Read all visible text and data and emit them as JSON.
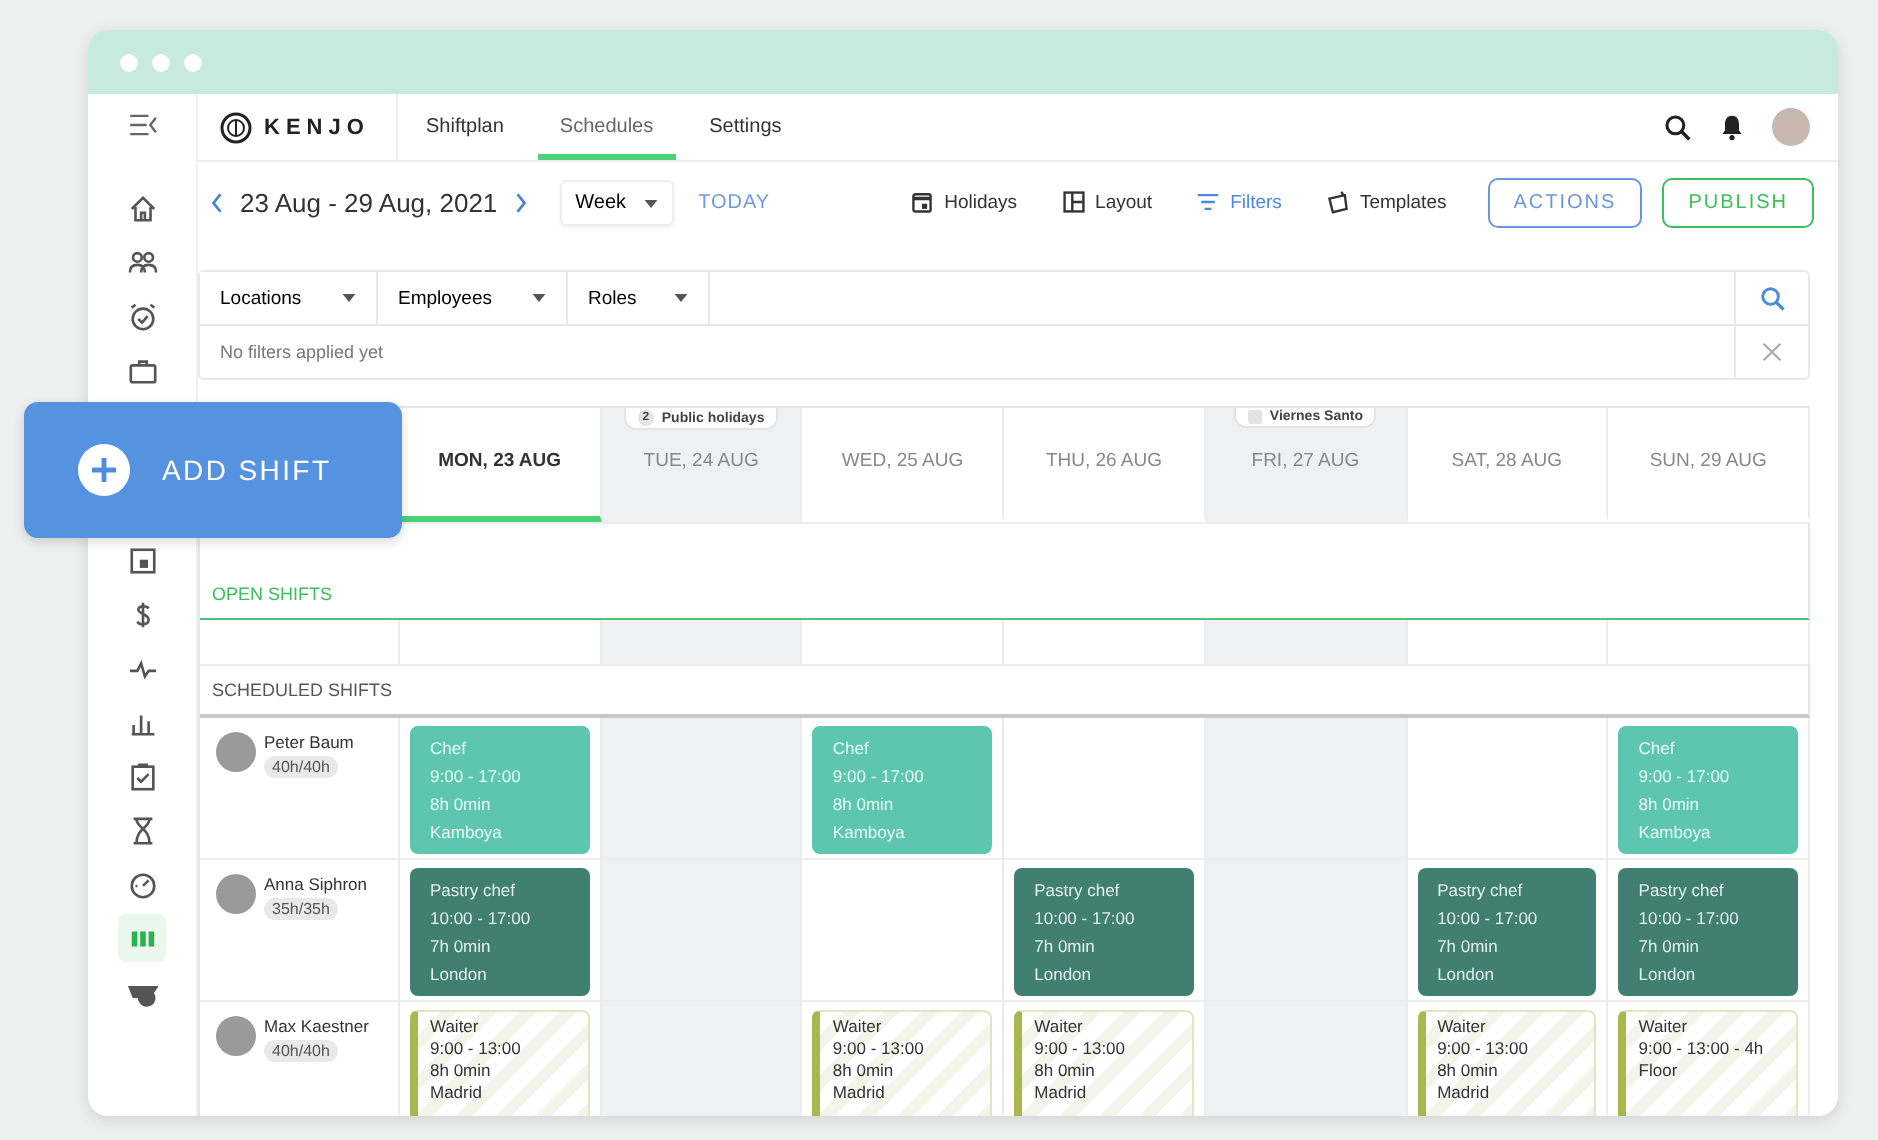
{
  "sidebar": {
    "items": [
      {
        "selected": false
      },
      {
        "selected": false
      },
      {
        "selected": false
      },
      {
        "selected": false
      },
      {
        "selected": false
      },
      {
        "selected": false
      },
      {
        "selected": false
      },
      {
        "selected": false
      },
      {
        "selected": false
      },
      {
        "selected": false
      },
      {
        "selected": false
      },
      {
        "selected": true
      },
      {
        "selected": false
      }
    ]
  },
  "header": {
    "logo": "KENJO",
    "tabs": [
      {
        "label": "Shiftplan",
        "selected": false
      },
      {
        "label": "Schedules",
        "selected": true
      },
      {
        "label": "Settings",
        "selected": false
      }
    ]
  },
  "toolbar": {
    "date_range": "23 Aug - 29 Aug, 2021",
    "view": "Week",
    "today": "TODAY",
    "tools": [
      {
        "label": "Holidays",
        "active": false
      },
      {
        "label": "Layout",
        "active": false
      },
      {
        "label": "Filters",
        "active": true
      },
      {
        "label": "Templates",
        "active": false
      }
    ],
    "buttons": [
      {
        "label": "ACTIONS",
        "kind": "secondary"
      },
      {
        "label": "PUBLISH",
        "kind": "primary"
      }
    ]
  },
  "filters": {
    "dropdowns": [
      "Locations",
      "Employees",
      "Roles"
    ],
    "status": "No filters applied yet"
  },
  "add_shift": "ADD SHIFT",
  "days": [
    {
      "label": "MON, 23 AUG",
      "selected": true,
      "holiday": false
    },
    {
      "label": "TUE, 24 AUG",
      "selected": false,
      "holiday": true,
      "badge": {
        "kind": "count",
        "count": "2",
        "text": "Public holidays"
      }
    },
    {
      "label": "WED, 25 AUG",
      "selected": false,
      "holiday": false
    },
    {
      "label": "THU, 26 AUG",
      "selected": false,
      "holiday": false
    },
    {
      "label": "FRI, 27 AUG",
      "selected": false,
      "holiday": true,
      "badge": {
        "kind": "named",
        "text": "Viernes Santo"
      }
    },
    {
      "label": "SAT, 28 AUG",
      "selected": false,
      "holiday": false
    },
    {
      "label": "SUN, 29 AUG",
      "selected": false,
      "holiday": false
    }
  ],
  "sections": {
    "open": "OPEN SHIFTS",
    "scheduled": "SCHEDULED SHIFTS"
  },
  "employees": [
    {
      "name": "Peter Baum",
      "hours": "40h/40h",
      "shifts": [
        {
          "kind": "teal",
          "lines": [
            "Chef",
            "9:00 - 17:00",
            "8h 0min",
            "Kamboya"
          ]
        },
        {
          "kind": "empty"
        },
        {
          "kind": "teal",
          "lines": [
            "Chef",
            "9:00 - 17:00",
            "8h 0min",
            "Kamboya"
          ]
        },
        {
          "kind": "empty"
        },
        {
          "kind": "empty"
        },
        {
          "kind": "empty"
        },
        {
          "kind": "teal",
          "lines": [
            "Chef",
            "9:00 - 17:00",
            "8h 0min",
            "Kamboya"
          ]
        }
      ]
    },
    {
      "name": "Anna Siphron",
      "hours": "35h/35h",
      "shifts": [
        {
          "kind": "forest",
          "lines": [
            "Pastry chef",
            "10:00 - 17:00",
            "7h 0min",
            "London"
          ]
        },
        {
          "kind": "empty"
        },
        {
          "kind": "empty"
        },
        {
          "kind": "forest",
          "lines": [
            "Pastry chef",
            "10:00 - 17:00",
            "7h 0min",
            "London"
          ]
        },
        {
          "kind": "empty"
        },
        {
          "kind": "forest",
          "lines": [
            "Pastry chef",
            "10:00 - 17:00",
            "7h 0min",
            "London"
          ]
        },
        {
          "kind": "forest",
          "lines": [
            "Pastry chef",
            "10:00 - 17:00",
            "7h 0min",
            "London"
          ]
        }
      ]
    },
    {
      "name": "Max Kaestner",
      "hours": "40h/40h",
      "shifts": [
        {
          "kind": "hatched",
          "lines": [
            "Waiter",
            "9:00 - 13:00",
            "8h 0min",
            "Madrid"
          ]
        },
        {
          "kind": "empty"
        },
        {
          "kind": "hatched",
          "lines": [
            "Waiter",
            "9:00 - 13:00",
            "8h 0min",
            "Madrid"
          ]
        },
        {
          "kind": "hatched",
          "lines": [
            "Waiter",
            "9:00 - 13:00",
            "8h 0min",
            "Madrid"
          ]
        },
        {
          "kind": "empty"
        },
        {
          "kind": "hatched",
          "lines": [
            "Waiter",
            "9:00 - 13:00",
            "8h 0min",
            "Madrid"
          ]
        },
        {
          "kind": "hatched",
          "lines": [
            "Waiter",
            "9:00 - 13:00 - 4h",
            "Floor"
          ]
        }
      ]
    }
  ]
}
